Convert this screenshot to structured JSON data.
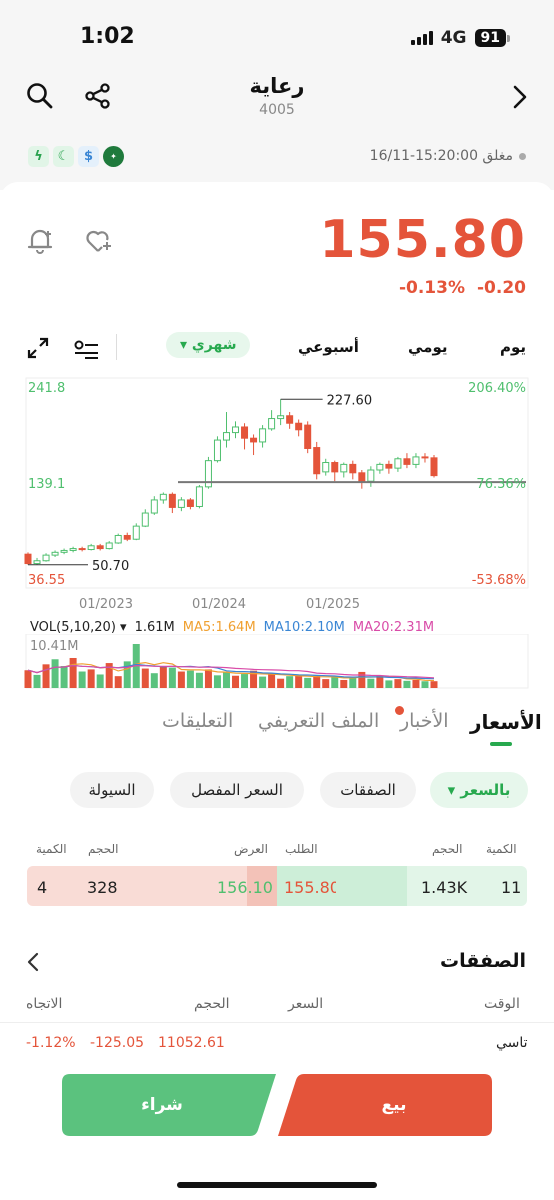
{
  "status": {
    "time": "1:02",
    "network": "4G",
    "battery": "91"
  },
  "header": {
    "title": "رعاية",
    "code": "4005"
  },
  "market": {
    "status_text": "مغلق 15:20:00-16/11"
  },
  "quote": {
    "price": "155.80",
    "change_pct": "-0.13%",
    "change": "-0.20"
  },
  "periods": {
    "day": "يوم",
    "daily": "يومي",
    "weekly": "أسبوعي",
    "monthly": "شهري"
  },
  "chart_data": {
    "type": "candlestick",
    "yaxis_left_top": "241.8",
    "yaxis_left_mid": "139.1",
    "yaxis_left_bottom": "36.55",
    "yaxis_right_top": "206.40%",
    "yaxis_right_mid": "76.36%",
    "yaxis_right_bottom": "-53.68%",
    "high_label": "227.60",
    "low_label": "50.70",
    "x_ticks": [
      "01/2023",
      "01/2024",
      "01/2025"
    ],
    "reference_line": 139.1,
    "ylim": [
      36.55,
      241.8
    ],
    "candles": [
      {
        "o": 62,
        "c": 52,
        "h": 64,
        "l": 50.7
      },
      {
        "o": 52,
        "c": 55,
        "h": 58,
        "l": 50.7
      },
      {
        "o": 55,
        "c": 61,
        "h": 63,
        "l": 54
      },
      {
        "o": 61,
        "c": 64,
        "h": 66,
        "l": 59
      },
      {
        "o": 64,
        "c": 66,
        "h": 68,
        "l": 62
      },
      {
        "o": 66,
        "c": 68,
        "h": 70,
        "l": 64
      },
      {
        "o": 68,
        "c": 67,
        "h": 70,
        "l": 65
      },
      {
        "o": 67,
        "c": 71,
        "h": 73,
        "l": 66
      },
      {
        "o": 71,
        "c": 68,
        "h": 73,
        "l": 66
      },
      {
        "o": 68,
        "c": 74,
        "h": 76,
        "l": 67
      },
      {
        "o": 74,
        "c": 82,
        "h": 84,
        "l": 73
      },
      {
        "o": 82,
        "c": 78,
        "h": 85,
        "l": 76
      },
      {
        "o": 78,
        "c": 92,
        "h": 95,
        "l": 77
      },
      {
        "o": 92,
        "c": 106,
        "h": 110,
        "l": 91
      },
      {
        "o": 106,
        "c": 120,
        "h": 124,
        "l": 104
      },
      {
        "o": 120,
        "c": 126,
        "h": 128,
        "l": 116
      },
      {
        "o": 126,
        "c": 112,
        "h": 128,
        "l": 106
      },
      {
        "o": 112,
        "c": 120,
        "h": 123,
        "l": 108
      },
      {
        "o": 120,
        "c": 113,
        "h": 122,
        "l": 110
      },
      {
        "o": 113,
        "c": 134,
        "h": 136,
        "l": 111
      },
      {
        "o": 134,
        "c": 162,
        "h": 166,
        "l": 132
      },
      {
        "o": 162,
        "c": 184,
        "h": 188,
        "l": 160
      },
      {
        "o": 184,
        "c": 192,
        "h": 214,
        "l": 176
      },
      {
        "o": 192,
        "c": 198,
        "h": 204,
        "l": 186
      },
      {
        "o": 198,
        "c": 186,
        "h": 202,
        "l": 174
      },
      {
        "o": 186,
        "c": 182,
        "h": 190,
        "l": 168
      },
      {
        "o": 182,
        "c": 196,
        "h": 200,
        "l": 176
      },
      {
        "o": 196,
        "c": 207,
        "h": 216,
        "l": 194
      },
      {
        "o": 207,
        "c": 210,
        "h": 227.6,
        "l": 200
      },
      {
        "o": 210,
        "c": 202,
        "h": 214,
        "l": 196
      },
      {
        "o": 202,
        "c": 195,
        "h": 206,
        "l": 188
      },
      {
        "o": 200,
        "c": 175,
        "h": 204,
        "l": 170
      },
      {
        "o": 176,
        "c": 148,
        "h": 182,
        "l": 142
      },
      {
        "o": 150,
        "c": 160,
        "h": 164,
        "l": 146
      },
      {
        "o": 160,
        "c": 150,
        "h": 162,
        "l": 140
      },
      {
        "o": 150,
        "c": 158,
        "h": 160,
        "l": 144
      },
      {
        "o": 158,
        "c": 149,
        "h": 162,
        "l": 142
      },
      {
        "o": 149,
        "c": 140,
        "h": 152,
        "l": 132
      },
      {
        "o": 140,
        "c": 152,
        "h": 156,
        "l": 134
      },
      {
        "o": 152,
        "c": 158,
        "h": 160,
        "l": 148
      },
      {
        "o": 158,
        "c": 154,
        "h": 162,
        "l": 148
      },
      {
        "o": 154,
        "c": 164,
        "h": 166,
        "l": 150
      },
      {
        "o": 164,
        "c": 158,
        "h": 170,
        "l": 154
      },
      {
        "o": 158,
        "c": 166,
        "h": 170,
        "l": 154
      },
      {
        "o": 166,
        "c": 165,
        "h": 170,
        "l": 160
      },
      {
        "o": 165,
        "c": 146,
        "h": 168,
        "l": 144
      }
    ]
  },
  "volume": {
    "label": "VOL(5,10,20)",
    "value": "1.61M",
    "ma5": "MA5:1.64M",
    "ma10": "MA10:2.10M",
    "ma20": "MA20:2.31M",
    "max": "10.41M",
    "bars": [
      4.2,
      3.1,
      5.6,
      6.8,
      5.2,
      7.1,
      3.9,
      4.4,
      3.2,
      5.9,
      2.8,
      6.3,
      10.41,
      4.6,
      3.5,
      5.1,
      4.8,
      3.9,
      4.1,
      3.6,
      4.4,
      3.0,
      3.7,
      2.9,
      3.3,
      4.1,
      2.7,
      3.5,
      2.2,
      2.8,
      3.1,
      2.4,
      2.9,
      2.1,
      2.6,
      1.9,
      2.4,
      3.8,
      2.2,
      3.0,
      1.8,
      2.1,
      1.7,
      1.9,
      1.6,
      1.61
    ],
    "colors": [
      "r",
      "g",
      "r",
      "g",
      "g",
      "r",
      "g",
      "r",
      "g",
      "r",
      "r",
      "g",
      "g",
      "r",
      "g",
      "r",
      "g",
      "r",
      "g",
      "g",
      "r",
      "g",
      "g",
      "r",
      "g",
      "r",
      "g",
      "r",
      "r",
      "g",
      "r",
      "g",
      "r",
      "r",
      "g",
      "r",
      "g",
      "r",
      "g",
      "r",
      "g",
      "r",
      "g",
      "r",
      "g",
      "r"
    ]
  },
  "tabs": {
    "prices": "الأسعار",
    "news": "الأخبار",
    "profile": "الملف التعريفي",
    "comments": "التعليقات"
  },
  "filters": {
    "by_price": "بالسعر",
    "trades": "الصفقات",
    "detailed_price": "السعر المفصل",
    "liquidity": "السيولة"
  },
  "orderbook": {
    "headers": {
      "bid_qty": "الكمية",
      "bid_vol": "الحجم",
      "bid": "الطلب",
      "ask": "العرض",
      "ask_vol": "الحجم",
      "ask_qty": "الكمية"
    },
    "bid_qty": "11",
    "bid_vol": "1.43K",
    "bid_price": "155.80",
    "ask_price": "156.10",
    "ask_vol": "328",
    "ask_qty": "4"
  },
  "trades": {
    "title": "الصفقات",
    "headers": {
      "time": "الوقت",
      "price": "السعر",
      "volume": "الحجم",
      "direction": "الاتجاه"
    },
    "row": {
      "name": "تاسي",
      "price": "11052.61",
      "change": "-125.05",
      "pct": "-1.12%"
    }
  },
  "actions": {
    "sell": "بيع",
    "buy": "شراء"
  },
  "colors": {
    "up": "#4fbf6e",
    "down": "#e4543a",
    "accent": "#27a94e"
  }
}
